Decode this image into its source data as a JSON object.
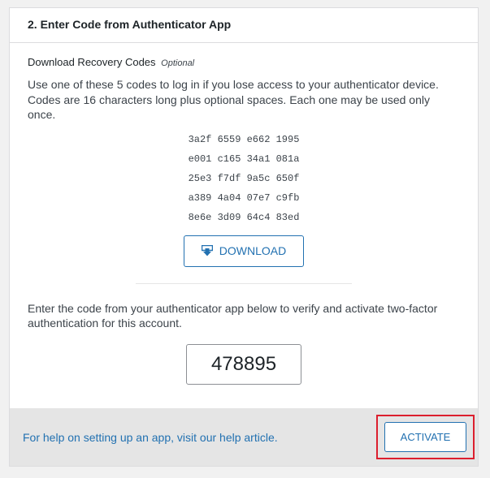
{
  "header": {
    "title": "2. Enter Code from Authenticator App"
  },
  "recovery": {
    "heading": "Download Recovery Codes",
    "optional": "Optional",
    "description": "Use one of these 5 codes to log in if you lose access to your authenticator device. Codes are 16 characters long plus optional spaces. Each one may be used only once.",
    "codes": [
      "3a2f 6559 e662 1995",
      "e001 c165 34a1 081a",
      "25e3 f7df 9a5c 650f",
      "a389 4a04 07e7 c9fb",
      "8e6e 3d09 64c4 83ed"
    ],
    "download_label": "DOWNLOAD",
    "download_icon": "download-icon"
  },
  "verify": {
    "description": "Enter the code from your authenticator app below to verify and activate two-factor authentication for this account.",
    "code_value": "478895"
  },
  "footer": {
    "help_text": "For help on setting up an app, visit our help article.",
    "activate_label": "ACTIVATE"
  },
  "colors": {
    "accent": "#2271b1",
    "highlight": "#dc1f2e",
    "footer_bg": "#e5e5e5"
  }
}
